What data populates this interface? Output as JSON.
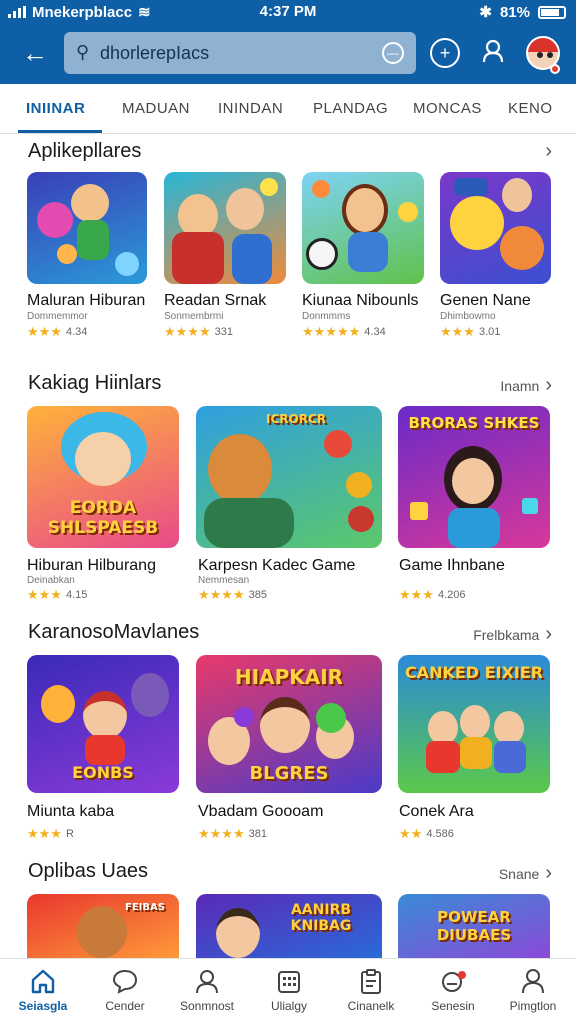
{
  "status": {
    "carrier": "Mnekerpblacc",
    "time": "4:37 PM",
    "battery": "81%"
  },
  "header": {
    "search_value": "dhorlerepIacs",
    "icons": [
      "back-arrow-icon",
      "search-icon",
      "clear-icon",
      "add-icon",
      "user-icon",
      "avatar"
    ]
  },
  "tabs": [
    {
      "label": "INIINAR",
      "active": true
    },
    {
      "label": "MADUAN",
      "active": false
    },
    {
      "label": "ININDAN",
      "active": false
    },
    {
      "label": "PLANDAG",
      "active": false
    },
    {
      "label": "MONCAS",
      "active": false
    },
    {
      "label": "KENO",
      "active": false
    }
  ],
  "sections": [
    {
      "title": "Aplikepllares",
      "more": "",
      "items": [
        {
          "title": "Maluran Hiburan",
          "sub": "Dommemmor",
          "rating": "4.34",
          "stars": "★★★"
        },
        {
          "title": "Readan Srnak",
          "sub": "Sonmembrmi",
          "rating": "331",
          "stars": "★★★★"
        },
        {
          "title": "Kiunaa Nibounls",
          "sub": "Donmmms",
          "rating": "4.34",
          "stars": "★★★★★"
        },
        {
          "title": "Genen Nane",
          "sub": "Dhimbowmo",
          "rating": "3.01",
          "stars": "★★★"
        }
      ]
    },
    {
      "title": "Kakiag Hiinlars",
      "more": "Inamn",
      "items": [
        {
          "title": "Hiburan Hilburang",
          "sub": "Deinabkan",
          "rating": "4.15",
          "stars": "★★★"
        },
        {
          "title": "Karpesn Kadec Game",
          "sub": "Nemmesan",
          "rating": "385",
          "stars": "★★★★"
        },
        {
          "title": "Game Ihnbane",
          "sub": "",
          "rating": "4.206",
          "stars": "★★★"
        }
      ]
    },
    {
      "title": "KaranosoMavlanes",
      "more": "Frelbkama",
      "items": [
        {
          "title": "Miunta kaba",
          "sub": "",
          "rating": "R",
          "stars": "★★★"
        },
        {
          "title": "Vbadam Goooam",
          "sub": "",
          "rating": "381",
          "stars": "★★★★"
        },
        {
          "title": "Conek Ara",
          "sub": "",
          "rating": "4.586",
          "stars": "★★"
        }
      ]
    },
    {
      "title": "Oplibas Uaes",
      "more": "Snane",
      "items": []
    }
  ],
  "thumb_words": {
    "k1": "EORDA SHLSPAESB",
    "k2": "ICRORCR",
    "k3": "BRORAS SHKES",
    "m1": "EONBS",
    "m2_top": "HIAPKAIR",
    "m2_bot": "BLGRES",
    "m3": "CANKED EIXIER",
    "o1": "FEIBAS",
    "o2": "AANIRB KNIBAG",
    "o3": "POWEAR DIUBAES"
  },
  "bottom_nav": [
    {
      "label": "Seiasgla",
      "icon": "home-icon",
      "active": true
    },
    {
      "label": "Cender",
      "icon": "chat-icon",
      "active": false
    },
    {
      "label": "Sonmnost",
      "icon": "profile-icon",
      "active": false
    },
    {
      "label": "Ulialgy",
      "icon": "calendar-icon",
      "active": false
    },
    {
      "label": "Cinanelk",
      "icon": "clipboard-icon",
      "active": false
    },
    {
      "label": "Senesin",
      "icon": "notification-icon",
      "active": false
    },
    {
      "label": "Pimgtlon",
      "icon": "person-icon",
      "active": false
    }
  ],
  "colors": {
    "brand": "#0f5fa6",
    "star": "#f2b01e",
    "badge": "#e53935"
  }
}
